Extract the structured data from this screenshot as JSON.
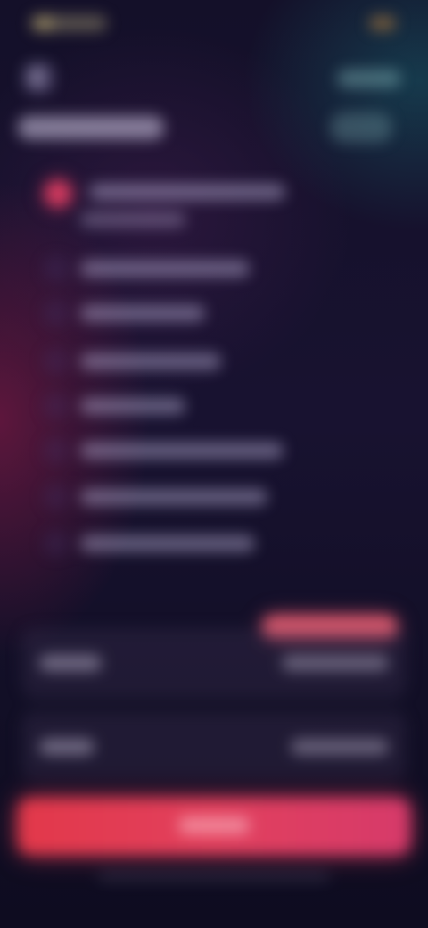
{
  "colors": {
    "background": "#141029",
    "accent": "#d33a5f",
    "cta": "#e2405d",
    "discount": "#e05a6e",
    "glow_left": "#961a46",
    "glow_right": "#165c68"
  },
  "icons": {
    "back": "chevron-left-icon"
  },
  "options": {
    "count": 8,
    "selected_index": 0
  }
}
